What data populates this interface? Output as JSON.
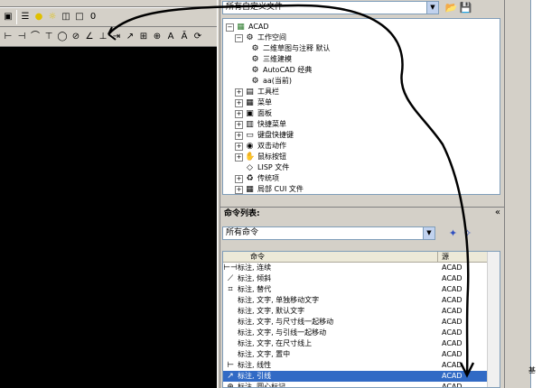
{
  "top_dropdown": {
    "value": "所有自定义文件"
  },
  "tree": {
    "root": "ACAD",
    "items": [
      {
        "label": "工作空间",
        "expander": "−"
      },
      {
        "label": "二维草图与注释 默认",
        "expander": ""
      },
      {
        "label": "三维建模",
        "expander": ""
      },
      {
        "label": "AutoCAD 经典",
        "expander": ""
      },
      {
        "label": "aa(当前)",
        "expander": ""
      },
      {
        "label": "工具栏",
        "expander": "+"
      },
      {
        "label": "菜单",
        "expander": "+"
      },
      {
        "label": "面板",
        "expander": "+"
      },
      {
        "label": "快捷菜单",
        "expander": "+"
      },
      {
        "label": "键盘快捷键",
        "expander": "+"
      },
      {
        "label": "双击动作",
        "expander": "+"
      },
      {
        "label": "鼠标按钮",
        "expander": "+"
      },
      {
        "label": "LISP 文件",
        "expander": ""
      },
      {
        "label": "传统项",
        "expander": "+"
      },
      {
        "label": "局部 CUI 文件",
        "expander": "+"
      }
    ]
  },
  "command_list": {
    "header": "命令列表:",
    "filter": "所有命令",
    "col_command": "命令",
    "col_source": "源",
    "rows": [
      {
        "name": "标注, 连续",
        "source": "ACAD"
      },
      {
        "name": "标注, 倾斜",
        "source": "ACAD"
      },
      {
        "name": "标注, 替代",
        "source": "ACAD"
      },
      {
        "name": "标注, 文字, 单独移动文字",
        "source": "ACAD"
      },
      {
        "name": "标注, 文字, 默认文字",
        "source": "ACAD"
      },
      {
        "name": "标注, 文字, 与尺寸线一起移动",
        "source": "ACAD"
      },
      {
        "name": "标注, 文字, 与引线一起移动",
        "source": "ACAD"
      },
      {
        "name": "标注, 文字, 在尺寸线上",
        "source": "ACAD"
      },
      {
        "name": "标注, 文字, 置中",
        "source": "ACAD"
      },
      {
        "name": "标注, 线性",
        "source": "ACAD"
      },
      {
        "name": "标注, 引线",
        "source": "ACAD"
      },
      {
        "name": "标注, 圆心标记",
        "source": "ACAD"
      }
    ],
    "selected_index": 10
  },
  "right_strip": {
    "label": "基"
  },
  "colors": {
    "selection": "#316ac5",
    "annotation_stroke": "#000000"
  }
}
